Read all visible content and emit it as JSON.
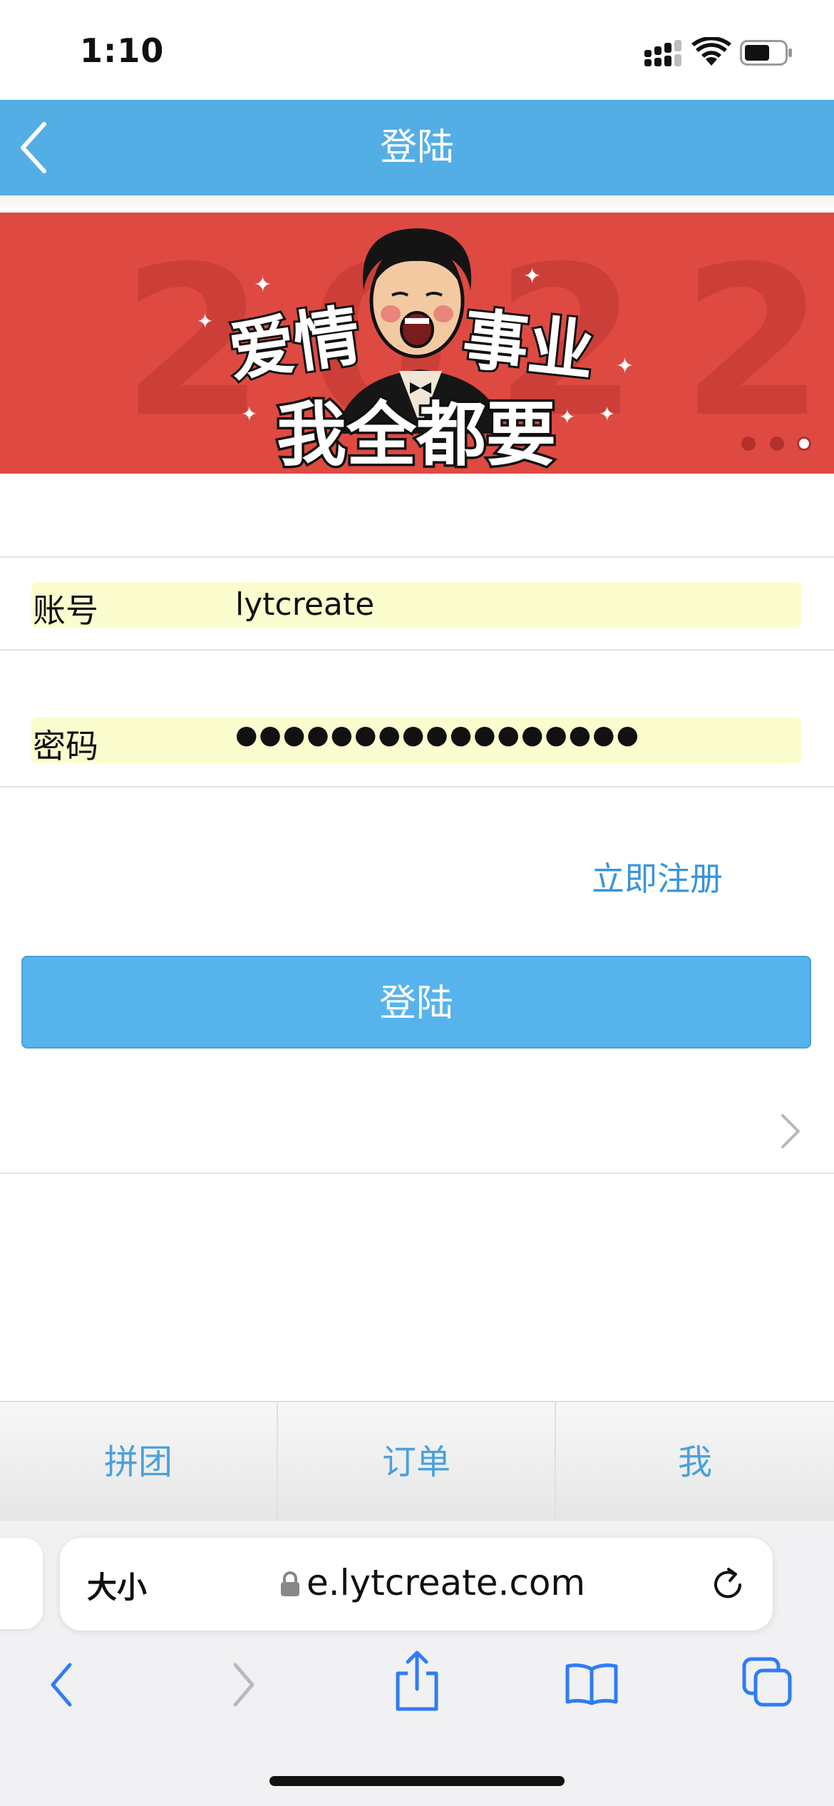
{
  "status_bar": {
    "time": "1:10"
  },
  "nav": {
    "title": "登陆"
  },
  "banner": {
    "words_left": "爱情",
    "words_right": "事业",
    "words_bottom": "我全都要",
    "bg_number": "2022",
    "slides": 3,
    "active_slide": 3
  },
  "form": {
    "account_label": "账号",
    "account_value": "lytcreate",
    "password_label": "密码",
    "password_value": "●●●●●●●●●●●●●●●●●",
    "register_link": "立即注册",
    "login_button": "登陆"
  },
  "tab_bar": {
    "tabs": [
      {
        "label": "拼团"
      },
      {
        "label": "订单"
      },
      {
        "label": "我"
      }
    ]
  },
  "safari": {
    "text_size_label": "大小",
    "url": "e.lytcreate.com"
  },
  "colors": {
    "nav_bg": "#54aee6",
    "banner_bg": "#de4a42",
    "field_bg": "#fbfdce",
    "link": "#3a94d8",
    "button_bg": "#57b3ec",
    "ios_blue": "#2f7cf6"
  },
  "icons": [
    "chevron-left-icon",
    "signal-icon",
    "wifi-icon",
    "battery-icon",
    "chevron-right-icon",
    "lock-icon",
    "reload-icon",
    "back-icon",
    "forward-icon",
    "share-icon",
    "bookmarks-icon",
    "tabs-icon"
  ]
}
